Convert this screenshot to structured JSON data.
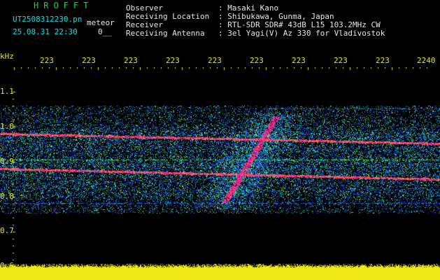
{
  "header": {
    "title": "HROFFT",
    "filename": "UT2508312230.pn",
    "tag": "meteor",
    "datetime": "25.08.31 22:30",
    "page": "0__"
  },
  "info": {
    "labels": [
      "Observer",
      "Receiving Location",
      "Receiver",
      "Receiving Antenna"
    ],
    "values": [
      ": Masaki Kano",
      ": Shibukawa, Gunma, Japan",
      ": RTL-SDR SDR# 43dB L15 103.2MHz CW",
      ": 3el Yagi(V) Az 330 for Vladivostok"
    ]
  },
  "axis": {
    "unit": "kHz",
    "time_ticks": [
      "223",
      "223",
      "223",
      "223",
      "223",
      "223",
      "223",
      "223",
      "223",
      "2240"
    ],
    "freq_ticks": [
      "1.1",
      "1.0",
      "0.9",
      "0.8",
      "0.7",
      "0.6"
    ]
  },
  "colors": {
    "label_yellow": "#e8e800",
    "title_green": "#00e040",
    "info_cyan": "#00e6e6"
  }
}
